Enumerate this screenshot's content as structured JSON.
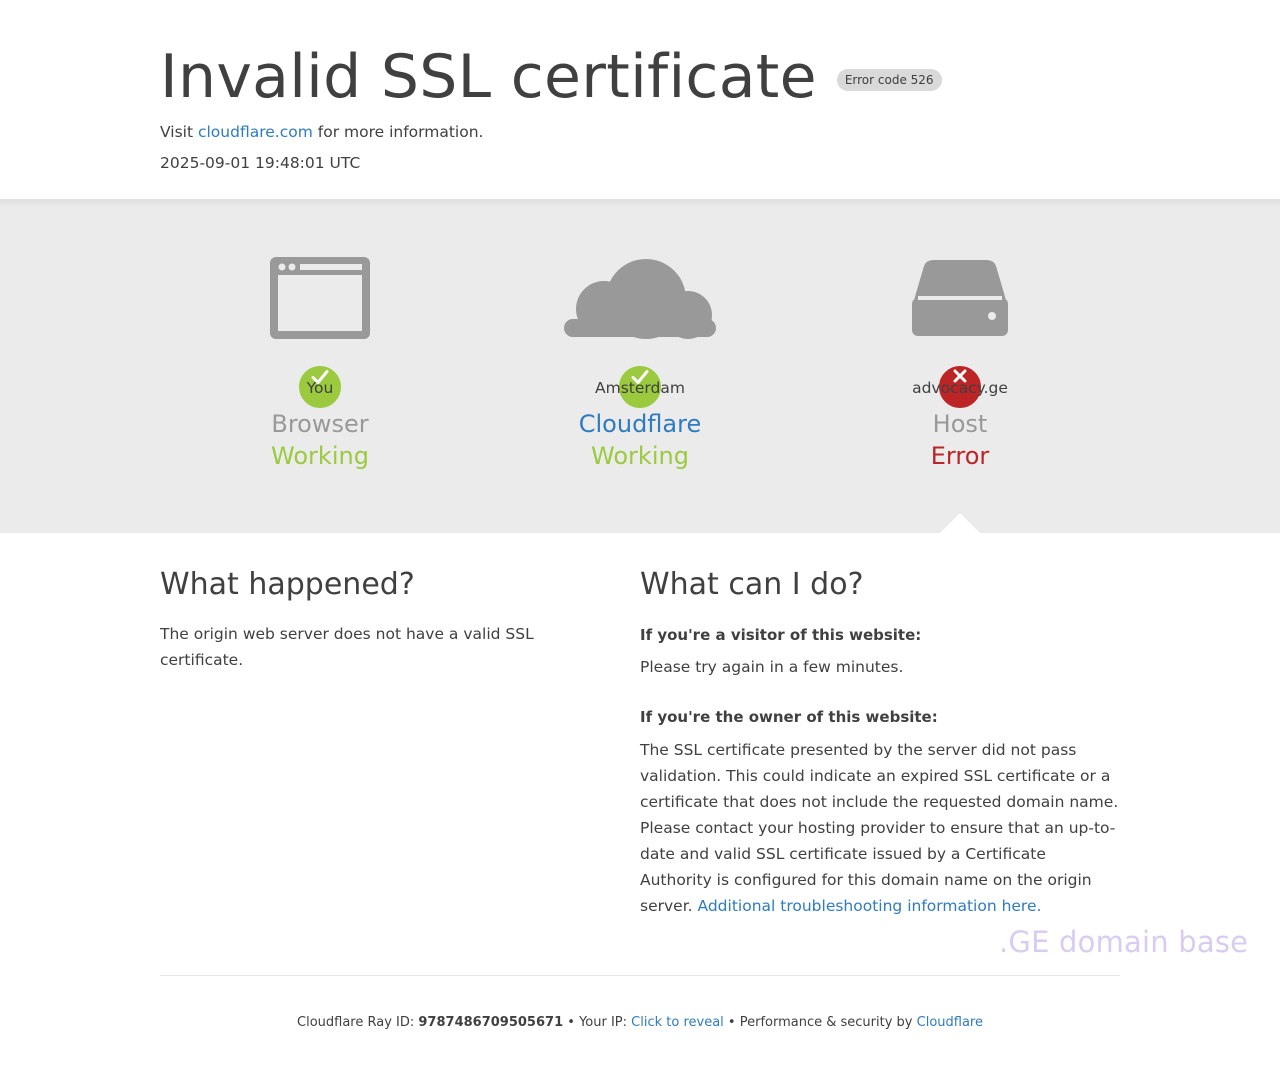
{
  "header": {
    "title": "Invalid SSL certificate",
    "error_badge": "Error code 526",
    "visit_prefix": "Visit",
    "visit_link": "cloudflare.com",
    "visit_suffix": "for more information.",
    "timestamp": "2025-09-01 19:48:01 UTC"
  },
  "status": [
    {
      "location": "You",
      "role": "Browser",
      "state": "Working",
      "icon": "browser-icon",
      "result_icon": "check-icon"
    },
    {
      "location": "Amsterdam",
      "role": "Cloudflare",
      "state": "Working",
      "icon": "cloud-icon",
      "result_icon": "check-icon"
    },
    {
      "location": "advocacy.ge",
      "role": "Host",
      "state": "Error",
      "icon": "server-icon",
      "result_icon": "x-icon"
    }
  ],
  "colors": {
    "ok": "#9bca3e",
    "error": "#bd2426",
    "link": "#2f7bbf",
    "icon_gray": "#999999"
  },
  "what_happened": {
    "heading": "What happened?",
    "text": "The origin web server does not have a valid SSL certificate."
  },
  "what_can_i_do": {
    "heading": "What can I do?",
    "visitor_heading": "If you're a visitor of this website:",
    "visitor_text": "Please try again in a few minutes.",
    "owner_heading": "If you're the owner of this website:",
    "owner_text": "The SSL certificate presented by the server did not pass validation. This could indicate an expired SSL certificate or a certificate that does not include the requested domain name. Please contact your hosting provider to ensure that an up-to-date and valid SSL certificate issued by a Certificate Authority is configured for this domain name on the origin server.",
    "owner_link": "Additional troubleshooting information here."
  },
  "watermark": ".GE domain base",
  "footer": {
    "ray_label": "Cloudflare Ray ID:",
    "ray_id": "9787486709505671",
    "sep1": "•",
    "ip_label": "Your IP:",
    "ip_link": "Click to reveal",
    "sep2": "•",
    "perf_label": "Performance & security by",
    "perf_link": "Cloudflare"
  }
}
